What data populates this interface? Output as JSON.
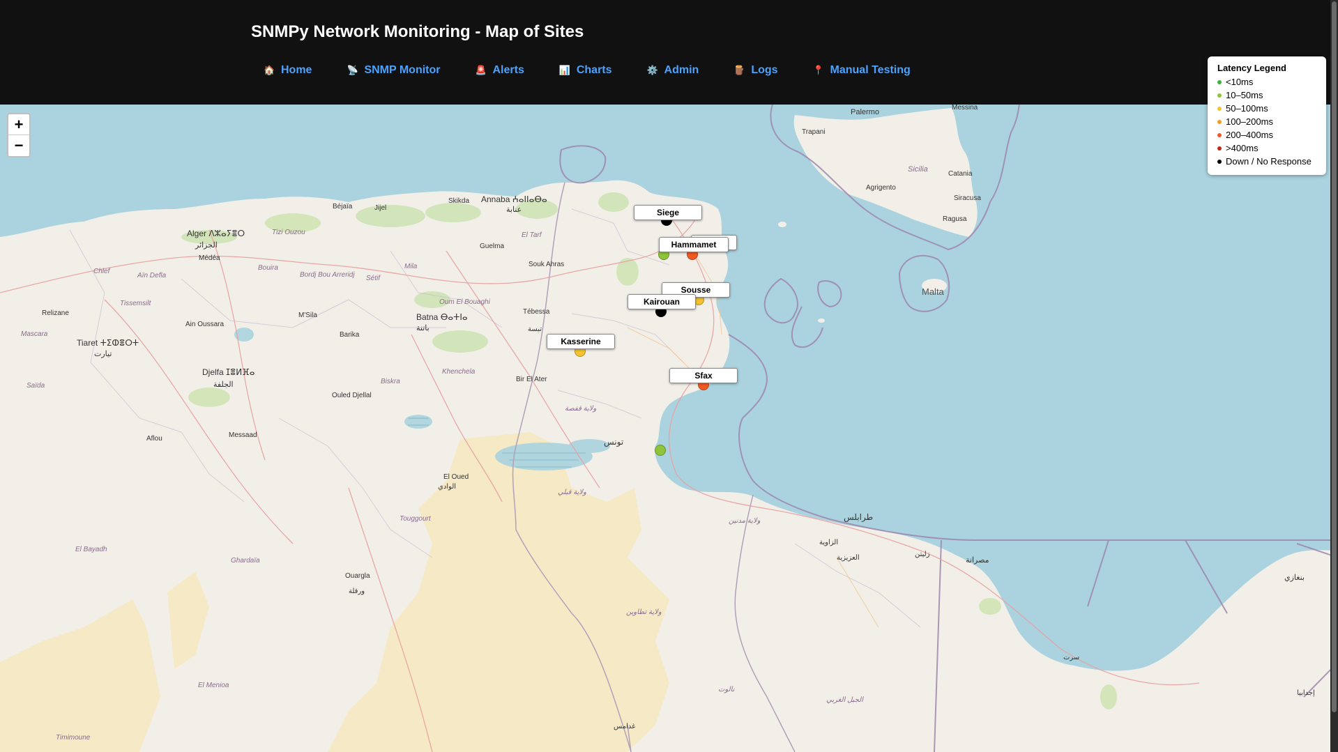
{
  "header": {
    "title": "SNMPy Network Monitoring - Map of Sites",
    "nav": [
      {
        "icon": "🏠",
        "icon_name": "home-icon",
        "label": "Home"
      },
      {
        "icon": "📡",
        "icon_name": "satellite-icon",
        "label": "SNMP Monitor"
      },
      {
        "icon": "🚨",
        "icon_name": "siren-icon",
        "label": "Alerts"
      },
      {
        "icon": "📊",
        "icon_name": "chart-icon",
        "label": "Charts"
      },
      {
        "icon": "⚙️",
        "icon_name": "gear-icon",
        "label": "Admin"
      },
      {
        "icon": "🪵",
        "icon_name": "log-icon",
        "label": "Logs"
      },
      {
        "icon": "📍",
        "icon_name": "pin-icon",
        "label": "Manual Testing"
      }
    ]
  },
  "zoom": {
    "in_label": "+",
    "out_label": "−"
  },
  "legend": {
    "title": "Latency Legend",
    "items": [
      {
        "label": "<10ms",
        "color": "#3cb43c"
      },
      {
        "label": "10–50ms",
        "color": "#8fc43a"
      },
      {
        "label": "50–100ms",
        "color": "#f2c230"
      },
      {
        "label": "100–200ms",
        "color": "#f39c1f"
      },
      {
        "label": "200–400ms",
        "color": "#f15a22"
      },
      {
        "label": ">400ms",
        "color": "#c0281c"
      },
      {
        "label": "Down / No Response",
        "color": "#000000"
      }
    ]
  },
  "sites": [
    {
      "name": "Siege",
      "color": "#000000",
      "status": "Down / No Response"
    },
    {
      "name": "Hammamet",
      "color": "#f15a22",
      "status": "200–400ms"
    },
    {
      "name": "Sousse",
      "color": "#f2c230",
      "status": "50–100ms"
    },
    {
      "name": "Kairouan",
      "color": "#000000",
      "status": "Down / No Response"
    },
    {
      "name": "Kasserine",
      "color": "#f2c230",
      "status": "50–100ms"
    },
    {
      "name": "Sfax",
      "color": "#f15a22",
      "status": "200–400ms"
    }
  ],
  "unlabeled_markers": [
    {
      "color": "#8fc43a"
    },
    {
      "color": "#8fc43a"
    }
  ],
  "map_places": [
    "Palermo",
    "Trapani",
    "Messina",
    "Sicilia",
    "Catania",
    "Agrigento",
    "Siracusa",
    "Ragusa",
    "Malta",
    "Alger ⴷⵣⴰⵢⴻⵔ",
    "الجزائر",
    "Médéa",
    "Béjaïa",
    "Jijel",
    "Skikda",
    "Annaba ⵄⴰⵏⵏⴰⴱⴰ",
    "عنابة",
    "Guelma",
    "Souk Ahras",
    "Batna ⴱⴰⵜⵏⴰ",
    "باتنة",
    "Tébessa",
    "تبسة",
    "M'Sila",
    "Barika",
    "Tiaret ⵜⵉⵀⴻⵔⵜ",
    "تيارت",
    "Djelfa ⵊⴻⵍⴼⴰ",
    "الجلفة",
    "Ain Oussara",
    "Relizane",
    "Mascara",
    "Saïda",
    "Bir El Ater",
    "Ouled Djellal",
    "Messaad",
    "Aflou",
    "El Oued",
    "الوادي",
    "Touggourt",
    "Ghardaïa",
    "Ouargla",
    "ورقلة",
    "El Bayadh",
    "El Menioa",
    "Timimoune",
    "تونس",
    "طرابلس",
    "الزاوية",
    "العزيزية",
    "زليتن",
    "مصراتة",
    "بنغازي",
    "سرت",
    "إجدابيا",
    "Tizi Ouzou",
    "Bouira",
    "Sétif",
    "Mila",
    "Oum El Bouaghi",
    "Khenchela",
    "Biskra",
    "Chlef",
    "Tissemsilt",
    "Aïn Defla",
    "Bordj Bou Arreridj",
    "El Tarf",
    "ولاية قفصة",
    "ولاية قبلي",
    "ولاية تطاوين",
    "ولاية مدنين",
    "غدامس",
    "نالوت",
    "الجبل الغربي"
  ]
}
